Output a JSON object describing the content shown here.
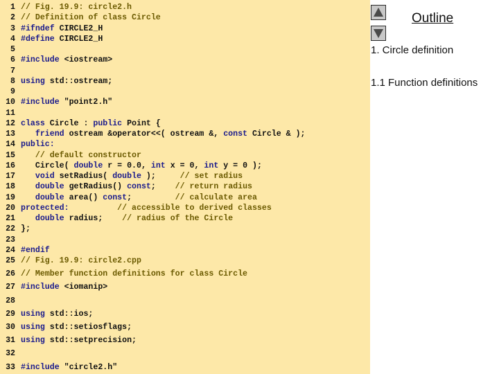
{
  "code_lines": [
    {
      "n": "1",
      "parts": [
        {
          "t": "// Fig. 19.9: circle2.h",
          "c": "cm"
        }
      ]
    },
    {
      "n": "2",
      "parts": [
        {
          "t": "// Definition of class Circle",
          "c": "cm"
        }
      ]
    },
    {
      "n": "3",
      "parts": [
        {
          "t": "#ifndef",
          "c": "kw"
        },
        {
          "t": " CIRCLE2_H"
        }
      ]
    },
    {
      "n": "4",
      "parts": [
        {
          "t": "#define",
          "c": "kw"
        },
        {
          "t": " CIRCLE2_H"
        }
      ]
    },
    {
      "n": "5",
      "parts": []
    },
    {
      "n": "6",
      "parts": [
        {
          "t": "#include",
          "c": "kw"
        },
        {
          "t": " <iostream>"
        }
      ]
    },
    {
      "n": "7",
      "parts": []
    },
    {
      "n": "8",
      "parts": [
        {
          "t": "using",
          "c": "kw"
        },
        {
          "t": " std::ostream;"
        }
      ]
    },
    {
      "n": "9",
      "parts": []
    },
    {
      "n": "10",
      "parts": [
        {
          "t": "#include",
          "c": "kw"
        },
        {
          "t": " \"point2.h\""
        }
      ]
    },
    {
      "n": "11",
      "parts": []
    },
    {
      "n": "12",
      "parts": [
        {
          "t": "class",
          "c": "kw"
        },
        {
          "t": " Circle : "
        },
        {
          "t": "public",
          "c": "kw"
        },
        {
          "t": " Point {"
        }
      ]
    },
    {
      "n": "13",
      "parts": [
        {
          "t": "   "
        },
        {
          "t": "friend",
          "c": "kw"
        },
        {
          "t": " ostream &operator<<( ostream &, "
        },
        {
          "t": "const",
          "c": "kw"
        },
        {
          "t": " Circle & );"
        }
      ]
    },
    {
      "n": "14",
      "parts": [
        {
          "t": "public:",
          "c": "kw"
        }
      ]
    },
    {
      "n": "15",
      "parts": [
        {
          "t": "   "
        },
        {
          "t": "// default constructor",
          "c": "cm"
        }
      ]
    },
    {
      "n": "16",
      "parts": [
        {
          "t": "   Circle( "
        },
        {
          "t": "double",
          "c": "kw"
        },
        {
          "t": " r = 0.0, "
        },
        {
          "t": "int",
          "c": "kw"
        },
        {
          "t": " x = 0, "
        },
        {
          "t": "int",
          "c": "kw"
        },
        {
          "t": " y = 0 );"
        }
      ]
    },
    {
      "n": "17",
      "parts": [
        {
          "t": "   "
        },
        {
          "t": "void",
          "c": "kw"
        },
        {
          "t": " setRadius( "
        },
        {
          "t": "double",
          "c": "kw"
        },
        {
          "t": " );     "
        },
        {
          "t": "// set radius",
          "c": "cm"
        }
      ]
    },
    {
      "n": "18",
      "parts": [
        {
          "t": "   "
        },
        {
          "t": "double",
          "c": "kw"
        },
        {
          "t": " getRadius() "
        },
        {
          "t": "const",
          "c": "kw"
        },
        {
          "t": ";    "
        },
        {
          "t": "// return radius",
          "c": "cm"
        }
      ]
    },
    {
      "n": "19",
      "parts": [
        {
          "t": "   "
        },
        {
          "t": "double",
          "c": "kw"
        },
        {
          "t": " area() "
        },
        {
          "t": "const",
          "c": "kw"
        },
        {
          "t": ";         "
        },
        {
          "t": "// calculate area",
          "c": "cm"
        }
      ]
    },
    {
      "n": "20",
      "parts": [
        {
          "t": "protected:",
          "c": "kw"
        },
        {
          "t": "          "
        },
        {
          "t": "// accessible to derived classes",
          "c": "cm"
        }
      ]
    },
    {
      "n": "21",
      "parts": [
        {
          "t": "   "
        },
        {
          "t": "double",
          "c": "kw"
        },
        {
          "t": " radius;    "
        },
        {
          "t": "// radius of the Circle",
          "c": "cm"
        }
      ]
    },
    {
      "n": "22",
      "parts": [
        {
          "t": "};"
        }
      ]
    },
    {
      "n": "23",
      "parts": []
    },
    {
      "n": "24",
      "parts": [
        {
          "t": "#endif",
          "c": "kw"
        }
      ]
    },
    {
      "n": "25",
      "parts": [
        {
          "t": "// Fig. 19.9: circle2.cpp",
          "c": "cm"
        }
      ]
    },
    {
      "n": "26",
      "parts": [
        {
          "t": "// Member function definitions for class Circle",
          "c": "cm"
        }
      ]
    },
    {
      "n": "27",
      "parts": [
        {
          "t": "#include",
          "c": "kw"
        },
        {
          "t": " <iomanip>"
        }
      ]
    },
    {
      "n": "28",
      "parts": []
    },
    {
      "n": "29",
      "parts": [
        {
          "t": "using",
          "c": "kw"
        },
        {
          "t": " std::ios;"
        }
      ]
    },
    {
      "n": "30",
      "parts": [
        {
          "t": "using",
          "c": "kw"
        },
        {
          "t": " std::setiosflags;"
        }
      ]
    },
    {
      "n": "31",
      "parts": [
        {
          "t": "using",
          "c": "kw"
        },
        {
          "t": " std::setprecision;"
        }
      ]
    },
    {
      "n": "32",
      "parts": []
    },
    {
      "n": "33",
      "parts": [
        {
          "t": "#include",
          "c": "kw"
        },
        {
          "t": " \"circle2.h\""
        }
      ]
    }
  ],
  "outline": {
    "title": "Outline",
    "items": [
      "1. Circle definition",
      "1.1 Function definitions"
    ]
  },
  "nav": {
    "up_icon": "triangle-up-icon",
    "down_icon": "triangle-down-icon"
  }
}
